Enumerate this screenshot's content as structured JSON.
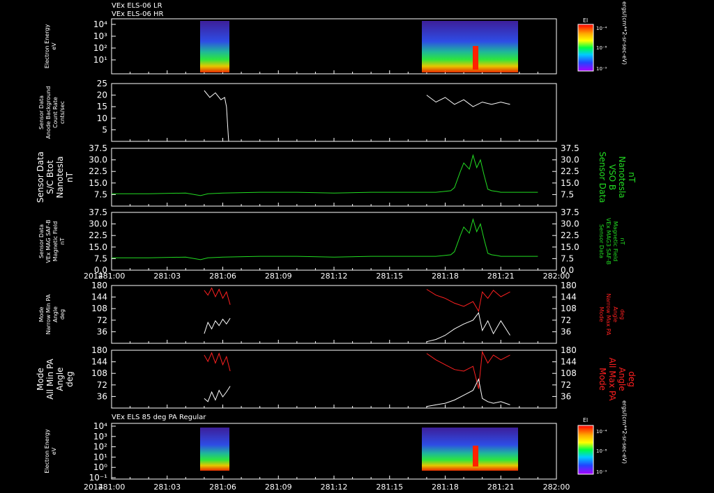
{
  "colors": {
    "background": "#000000",
    "axis": "#ffffff",
    "white_trace": "#ffffff",
    "green_trace": "#22dd22",
    "red_trace": "#ff2020"
  },
  "header": {
    "line1": "VEx ELS-06 LR",
    "line2": "VEx ELS-06 HR"
  },
  "x_axis": {
    "year": "2014",
    "ticks": [
      "281:00",
      "281:03",
      "281:06",
      "281:09",
      "281:12",
      "281:15",
      "281:18",
      "281:21",
      "282:00"
    ]
  },
  "colorbar": {
    "title": "El",
    "top_label": "10⁻⁴",
    "mid_label": "10⁻⁸",
    "bottom_label": "10⁻⁹",
    "units": "ergs/(cm**2-sr-sec-eV)"
  },
  "chart_data": [
    {
      "type": "heatmap",
      "panel": "spectrogram-top",
      "ylabel": [
        "Electron Energy",
        "eV"
      ],
      "y_ticks": [
        "10⁴",
        "10³",
        "10²",
        "10¹"
      ],
      "segments": [
        [
          "281:05",
          "281:06.5"
        ],
        [
          "281:17",
          "281:21.5"
        ]
      ]
    },
    {
      "type": "line",
      "panel": "background-counts",
      "ylabel": [
        "Sensor Data",
        "Anode Background",
        "Count Rate",
        "cnts/sec"
      ],
      "ylim": [
        0,
        25
      ],
      "y_ticks": [
        "25",
        "20",
        "15",
        "10",
        "5"
      ],
      "series": [
        {
          "color": "white",
          "x": [
            5.0,
            5.3,
            5.6,
            5.9,
            6.1,
            6.2,
            6.3,
            6.32
          ],
          "y": [
            22,
            19,
            21,
            18,
            19,
            15,
            2,
            0
          ]
        },
        {
          "color": "white",
          "x": [
            17.0,
            17.5,
            18.0,
            18.5,
            19.0,
            19.5,
            20.0,
            20.5,
            21.0,
            21.5
          ],
          "y": [
            20,
            17,
            19,
            16,
            18,
            15,
            17,
            16,
            17,
            16
          ]
        }
      ]
    },
    {
      "type": "line",
      "panel": "btot",
      "ylabel_left": [
        "Sensor Data",
        "S/C Btot",
        "Nanotesla",
        "nT"
      ],
      "ylabel_right": [
        "Sensor Data",
        "VSO B",
        "Nanotesla",
        "nT"
      ],
      "ylim": [
        0,
        37.5
      ],
      "y_ticks": [
        "37.5",
        "30.0",
        "22.5",
        "15.0",
        "7.5"
      ],
      "series": [
        {
          "color": "green",
          "x": [
            0,
            2,
            4,
            4.8,
            5.2,
            6,
            8,
            10,
            12,
            14,
            16,
            17.5,
            18.3,
            18.5,
            18.8,
            19.0,
            19.3,
            19.5,
            19.7,
            19.9,
            20.1,
            20.3,
            20.5,
            20.8,
            21,
            22,
            23
          ],
          "y": [
            8,
            8,
            8.5,
            6.8,
            8,
            8.5,
            9,
            9,
            8.5,
            9,
            9,
            9,
            10,
            12,
            22,
            28,
            24,
            33,
            25,
            30,
            20,
            11,
            10,
            9.5,
            9,
            9,
            9
          ]
        }
      ]
    },
    {
      "type": "line",
      "panel": "mag-field",
      "ylabel_left": [
        "Sensor Data",
        "VEx MAG SAF-B",
        "Magnetic Field",
        "nT"
      ],
      "ylabel_right": [
        "Sensor Data",
        "VEx MAG3 SAF-B",
        "Magnetic Field",
        "nT"
      ],
      "ylim": [
        0,
        37.5
      ],
      "y_ticks": [
        "37.5",
        "30.0",
        "22.5",
        "15.0",
        "7.5",
        "0.0"
      ],
      "series": [
        {
          "color": "green",
          "x": [
            0,
            2,
            4,
            4.8,
            5.2,
            6,
            8,
            10,
            12,
            14,
            16,
            17.5,
            18.3,
            18.5,
            18.8,
            19.0,
            19.3,
            19.5,
            19.7,
            19.9,
            20.1,
            20.3,
            20.5,
            20.8,
            21,
            22,
            23
          ],
          "y": [
            8,
            8,
            8.5,
            6.8,
            8,
            8.5,
            9,
            9,
            8.5,
            9,
            9,
            9,
            10,
            12,
            22,
            28,
            24,
            33,
            25,
            30,
            20,
            11,
            10,
            9.5,
            9,
            9,
            9
          ]
        }
      ]
    },
    {
      "type": "line",
      "panel": "narrow-pa",
      "ylabel_left": [
        "Mode",
        "Narrow Min PA",
        "Angle",
        "deg"
      ],
      "ylabel_right": [
        "Mode",
        "Narrow Max PA",
        "Angle",
        "deg"
      ],
      "ylim": [
        0,
        180
      ],
      "y_ticks": [
        "180",
        "144",
        "108",
        "72",
        "36"
      ],
      "series": [
        {
          "color": "red",
          "x": [
            5.0,
            5.2,
            5.4,
            5.6,
            5.8,
            6.0,
            6.2,
            6.4
          ],
          "y": [
            165,
            150,
            172,
            145,
            168,
            140,
            160,
            120
          ]
        },
        {
          "color": "white",
          "x": [
            5.0,
            5.2,
            5.4,
            5.6,
            5.8,
            6.0,
            6.2,
            6.4
          ],
          "y": [
            30,
            65,
            45,
            70,
            55,
            75,
            60,
            78
          ]
        },
        {
          "color": "red",
          "x": [
            17.0,
            17.5,
            18.0,
            18.5,
            19.0,
            19.5,
            19.8,
            20.0,
            20.3,
            20.6,
            21.0,
            21.5
          ],
          "y": [
            168,
            150,
            140,
            125,
            115,
            130,
            100,
            160,
            140,
            165,
            145,
            160
          ]
        },
        {
          "color": "white",
          "x": [
            17.0,
            17.5,
            18.0,
            18.5,
            19.0,
            19.5,
            19.8,
            20.0,
            20.3,
            20.6,
            21.0,
            21.5
          ],
          "y": [
            5,
            12,
            25,
            45,
            60,
            72,
            95,
            40,
            70,
            30,
            70,
            25
          ]
        }
      ]
    },
    {
      "type": "line",
      "panel": "all-pa",
      "ylabel_left": [
        "Mode",
        "All Min PA",
        "Angle",
        "deg"
      ],
      "ylabel_right": [
        "Mode",
        "All Max PA",
        "Angle",
        "deg"
      ],
      "ylim": [
        0,
        180
      ],
      "y_ticks": [
        "180",
        "144",
        "108",
        "72",
        "36"
      ],
      "series": [
        {
          "color": "red",
          "x": [
            5.0,
            5.2,
            5.4,
            5.6,
            5.8,
            6.0,
            6.2,
            6.4
          ],
          "y": [
            165,
            145,
            172,
            140,
            170,
            135,
            160,
            115
          ]
        },
        {
          "color": "white",
          "x": [
            5.0,
            5.2,
            5.4,
            5.6,
            5.8,
            6.0,
            6.2,
            6.4
          ],
          "y": [
            30,
            20,
            50,
            25,
            55,
            35,
            50,
            68
          ]
        },
        {
          "color": "red",
          "x": [
            17.0,
            17.5,
            18.0,
            18.5,
            19.0,
            19.5,
            19.8,
            20.0,
            20.3,
            20.6,
            21.0,
            21.5
          ],
          "y": [
            170,
            150,
            135,
            120,
            115,
            130,
            60,
            175,
            140,
            165,
            150,
            165
          ]
        },
        {
          "color": "white",
          "x": [
            17.0,
            17.5,
            18.0,
            18.5,
            19.0,
            19.5,
            19.8,
            20.0,
            20.3,
            20.6,
            21.0,
            21.5
          ],
          "y": [
            5,
            10,
            15,
            25,
            40,
            55,
            90,
            30,
            20,
            15,
            20,
            10
          ]
        }
      ]
    },
    {
      "type": "heatmap",
      "panel": "spectrogram-bottom",
      "title": "VEx ELS 85 deg PA Regular",
      "ylabel": [
        "Electron Energy",
        "eV"
      ],
      "y_ticks": [
        "10⁴",
        "10³",
        "10²",
        "10¹",
        "10⁰",
        "10⁻¹"
      ],
      "segments": [
        [
          "281:05",
          "281:06.5"
        ],
        [
          "281:17",
          "281:21.5"
        ]
      ]
    }
  ]
}
